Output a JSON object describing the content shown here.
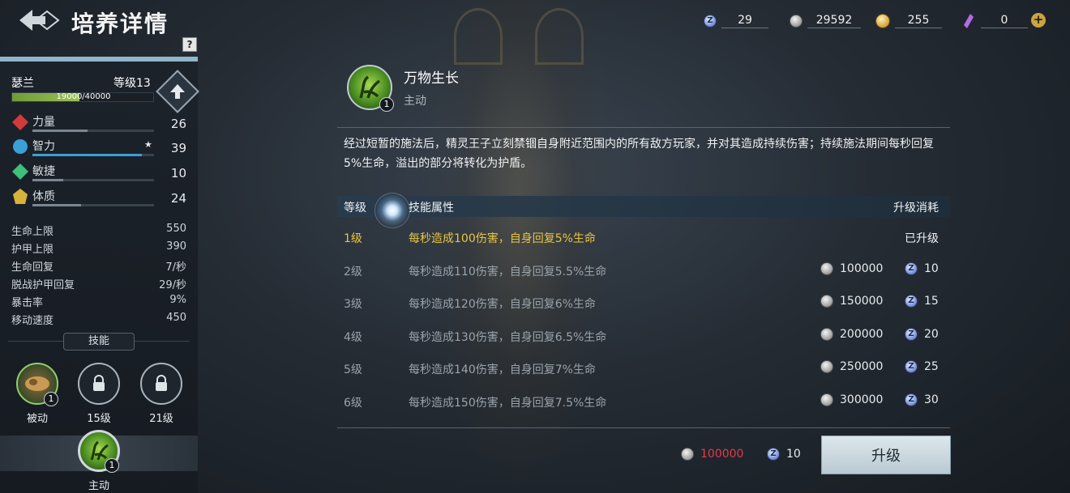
{
  "header": {
    "title": "培养详情",
    "help_label": "?"
  },
  "currencies": [
    {
      "icon": "blue-gem-icon",
      "value": "29"
    },
    {
      "icon": "silver-coin-icon",
      "value": "29592"
    },
    {
      "icon": "gold-coin-icon",
      "value": "255"
    },
    {
      "icon": "purple-crystal-icon",
      "value": "0"
    }
  ],
  "hero": {
    "name": "瑟兰",
    "level_label": "等级13",
    "exp_text": "19000/40000",
    "exp_fraction": 0.475
  },
  "attributes": [
    {
      "label": "力量",
      "value": "26",
      "bar": 0.45,
      "color": "#d23a3a",
      "icon": "strength-icon",
      "star": false
    },
    {
      "label": "智力",
      "value": "39",
      "bar": 0.9,
      "color": "#3aa0d8",
      "icon": "intelligence-icon",
      "star": true
    },
    {
      "label": "敏捷",
      "value": "10",
      "bar": 0.25,
      "color": "#3fbf7a",
      "icon": "agility-icon",
      "star": false
    },
    {
      "label": "体质",
      "value": "24",
      "bar": 0.4,
      "color": "#d8b23a",
      "icon": "constitution-icon",
      "star": false
    }
  ],
  "stats": [
    {
      "label": "生命上限",
      "value": "550"
    },
    {
      "label": "护甲上限",
      "value": "390"
    },
    {
      "label": "生命回复",
      "value": "7/秒"
    },
    {
      "label": "脱战护甲回复",
      "value": "29/秒"
    },
    {
      "label": "暴击率",
      "value": "9%"
    },
    {
      "label": "移动速度",
      "value": "450"
    }
  ],
  "skills_section": {
    "label": "技能",
    "slots": [
      {
        "name": "被动",
        "badge": "1",
        "icon": "passive-skill-icon",
        "locked": false
      },
      {
        "name": "15级",
        "badge": "",
        "icon": "lock-icon",
        "locked": true
      },
      {
        "name": "21级",
        "badge": "",
        "icon": "lock-icon",
        "locked": true
      }
    ],
    "active": {
      "name": "主动",
      "badge": "1"
    }
  },
  "skill_detail": {
    "title": "万物生长",
    "type": "主动",
    "badge": "1",
    "description": "经过短暂的施法后，精灵王子立刻禁锢自身附近范围内的所有敌方玩家，并对其造成持续伤害；持续施法期间每秒回复5%生命，溢出的部分将转化为护盾。",
    "table_headers": {
      "level": "等级",
      "attr": "技能属性",
      "cost": "升级消耗"
    },
    "levels": [
      {
        "level": "1级",
        "attr": "每秒造成100伤害，自身回复5%生命",
        "status": "已升级",
        "coins": "",
        "gems": "",
        "current": true
      },
      {
        "level": "2级",
        "attr": "每秒造成110伤害，自身回复5.5%生命",
        "status": "",
        "coins": "100000",
        "gems": "10",
        "current": false
      },
      {
        "level": "3级",
        "attr": "每秒造成120伤害，自身回复6%生命",
        "status": "",
        "coins": "150000",
        "gems": "15",
        "current": false
      },
      {
        "level": "4级",
        "attr": "每秒造成130伤害，自身回复6.5%生命",
        "status": "",
        "coins": "200000",
        "gems": "20",
        "current": false
      },
      {
        "level": "5级",
        "attr": "每秒造成140伤害，自身回复7%生命",
        "status": "",
        "coins": "250000",
        "gems": "25",
        "current": false
      },
      {
        "level": "6级",
        "attr": "每秒造成150伤害，自身回复7.5%生命",
        "status": "",
        "coins": "300000",
        "gems": "30",
        "current": false
      }
    ],
    "upgrade_cost": {
      "coins": "100000",
      "gems": "10"
    },
    "upgrade_button": "升级"
  },
  "colors": {
    "accent_blue": "#8fb7c9",
    "current_level": "#e9c542",
    "insufficient": "#e5394a"
  }
}
